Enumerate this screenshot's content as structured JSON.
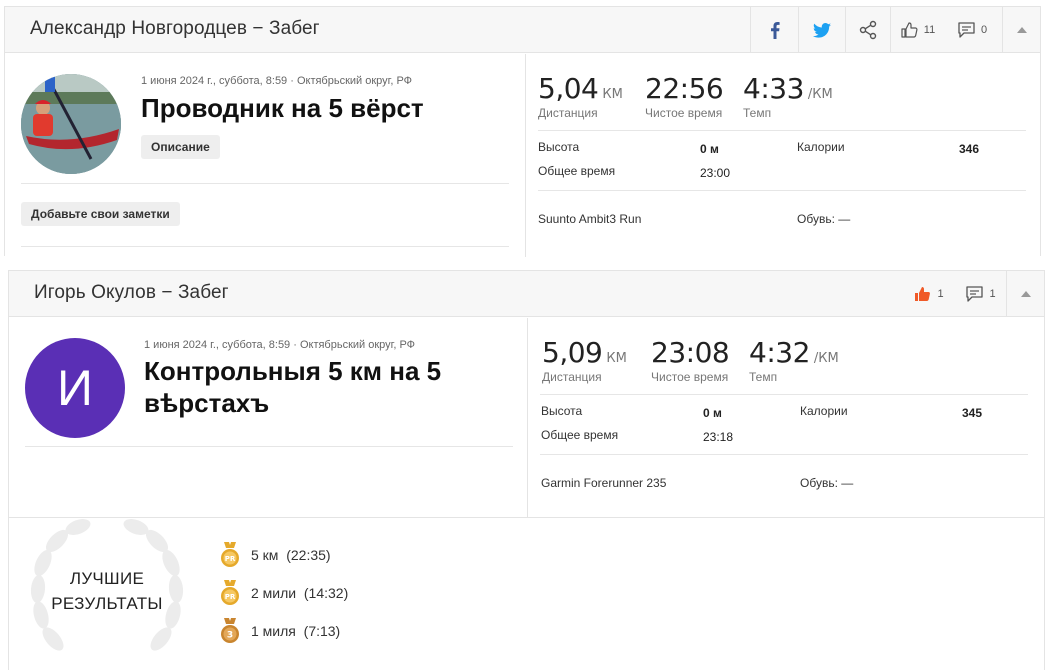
{
  "activity1": {
    "header_title": "Александр Новгородцев − Забег",
    "likes": "11",
    "comments": "0",
    "meta": "1 июня 2024 г., суббота, 8:59 · Октябрьский округ, РФ",
    "title": "Проводник на 5 вёрст",
    "description_button": "Описание",
    "notes_button": "Добавьте свои заметки",
    "distance_value": "5,04",
    "distance_unit": "КМ",
    "distance_label": "Дистанция",
    "time_value": "22:56",
    "time_label": "Чистое время",
    "pace_value": "4:33",
    "pace_unit": "/КМ",
    "pace_label": "Темп",
    "elevation_label": "Высота",
    "elevation_value": "0 м",
    "calories_label": "Калории",
    "calories_value": "346",
    "total_time_label": "Общее время",
    "total_time_value": "23:00",
    "device": "Suunto Ambit3 Run",
    "shoes_label": "Обувь: —"
  },
  "activity2": {
    "header_title": "Игорь Окулов − Забег",
    "likes": "1",
    "comments": "1",
    "avatar_letter": "И",
    "meta": "1 июня 2024 г., суббота, 8:59 · Октябрьский округ, РФ",
    "title_line1": "Контрольныя 5 км на 5",
    "title_line2": "вѣрстахъ",
    "distance_value": "5,09",
    "distance_unit": "КМ",
    "distance_label": "Дистанция",
    "time_value": "23:08",
    "time_label": "Чистое время",
    "pace_value": "4:32",
    "pace_unit": "/КМ",
    "pace_label": "Темп",
    "elevation_label": "Высота",
    "elevation_value": "0 м",
    "calories_label": "Калории",
    "calories_value": "345",
    "total_time_label": "Общее время",
    "total_time_value": "23:18",
    "device": "Garmin Forerunner 235",
    "shoes_label": "Обувь: —",
    "best_results_line1": "ЛУЧШИЕ",
    "best_results_line2": "РЕЗУЛЬТАТЫ",
    "best_results": [
      {
        "label": "5 км  (22:35)",
        "medal": "PR"
      },
      {
        "label": "2 мили  (14:32)",
        "medal": "PR"
      },
      {
        "label": "1 миля  (7:13)",
        "medal": "3"
      }
    ]
  },
  "colors": {
    "facebook": "#3b5998",
    "twitter": "#1da1f2",
    "avatar_purple": "#5a2fb5",
    "like_active": "#f05a28",
    "medal_gold": "#e5a92b"
  }
}
